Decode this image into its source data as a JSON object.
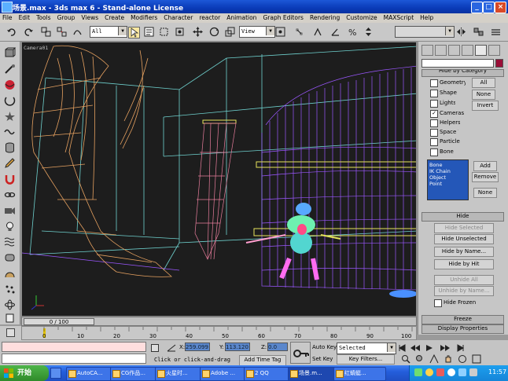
{
  "window": {
    "title": "场景.max - 3ds max 6 - Stand-alone License",
    "min": "_",
    "max": "□",
    "close": "×"
  },
  "menu": [
    "File",
    "Edit",
    "Tools",
    "Group",
    "Views",
    "Create",
    "Modifiers",
    "Character",
    "reactor",
    "Animation",
    "Graph Editors",
    "Rendering",
    "Customize",
    "MAXScript",
    "Help"
  ],
  "toolbar": {
    "selection_filter": "All",
    "reference_coord": "View"
  },
  "viewport": {
    "label": "Camera01"
  },
  "panel": {
    "rollout_hide_by_category": "Hide by Category",
    "categories": [
      {
        "label": "Geometry",
        "checked": false
      },
      {
        "label": "Shape",
        "checked": false
      },
      {
        "label": "Lights",
        "checked": false
      },
      {
        "label": "Cameras",
        "checked": true
      },
      {
        "label": "Helpers",
        "checked": false
      },
      {
        "label": "Space Warps",
        "checked": false
      },
      {
        "label": "Particle",
        "checked": false
      },
      {
        "label": "Bone",
        "checked": false
      }
    ],
    "btn_all": "All",
    "btn_none": "None",
    "btn_invert": "Invert",
    "list_items": [
      "Bone",
      "IK Chain Object",
      "Point"
    ],
    "btn_add": "Add",
    "btn_remove": "Remove",
    "btn_none2": "None",
    "rollout_hide": "Hide",
    "hide_selected": "Hide Selected",
    "hide_unselected": "Hide Unselected",
    "hide_by_name": "Hide by Name...",
    "hide_by_hit": "Hide by Hit",
    "unhide_all": "Unhide All",
    "unhide_by_name": "Unhide by Name...",
    "hide_frozen": "Hide Frozen",
    "rollout_freeze": "Freeze",
    "rollout_display_props": "Display Properties"
  },
  "timeline": {
    "frame": "0 / 100",
    "ticks": [
      "0",
      "10",
      "20",
      "30",
      "40",
      "50",
      "60",
      "70",
      "80",
      "90",
      "100"
    ]
  },
  "status": {
    "x_label": "X:",
    "x_value": "259.099",
    "y_label": "Y:",
    "y_value": "113.120",
    "z_label": "Z:",
    "z_value": "0.0",
    "auto_key": "Auto Key",
    "key_mode": "Selected",
    "set_key": "Set Key",
    "key_filters": "Key Filters...",
    "prompt": "Click or click-and-drag",
    "add_time_tag": "Add Time Tag"
  },
  "taskbar": {
    "start": "开始",
    "tasks": [
      "AutoCA...",
      "CG作品...",
      "火星时...",
      "Adobe ...",
      "2 QQ",
      "场景.m...",
      "红蜻蜓..."
    ],
    "clock": "11:57"
  },
  "colors": {
    "titlebar": "#0a3bb8",
    "viewport_bg": "#1d1d1d",
    "wire_orange": "#e8a060",
    "wire_purple": "#a060ff",
    "wire_cyan": "#70d8d0",
    "wire_yellow": "#e8e860"
  }
}
